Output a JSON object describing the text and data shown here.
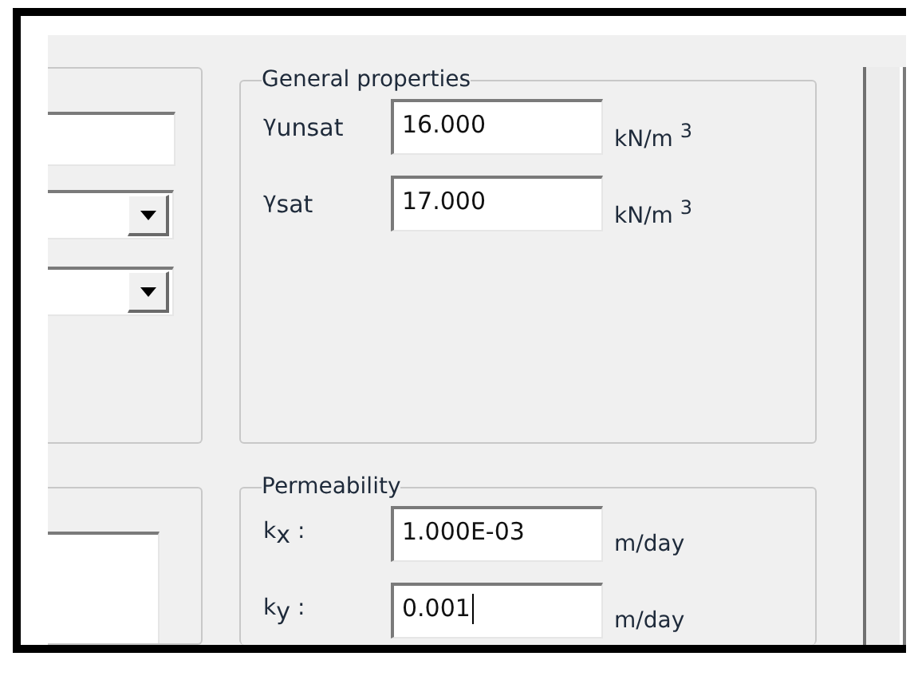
{
  "general_properties": {
    "title": "General properties",
    "rows": [
      {
        "label": "γ$_{unsat}$",
        "value": "16.000",
        "unit": "kN/m $^{3}$",
        "focused": false
      },
      {
        "label": "γ$_{sat}$",
        "value": "17.000",
        "unit": "kN/m $^{3}$",
        "focused": false
      }
    ]
  },
  "permeability": {
    "title": "Permeability",
    "rows": [
      {
        "label": "k$_{x}$ :",
        "value": "1.000E-03",
        "unit": "m/day",
        "focused": false
      },
      {
        "label": "k$_{y}$ :",
        "value": "0.001",
        "unit": "m/day",
        "focused": true
      }
    ]
  }
}
